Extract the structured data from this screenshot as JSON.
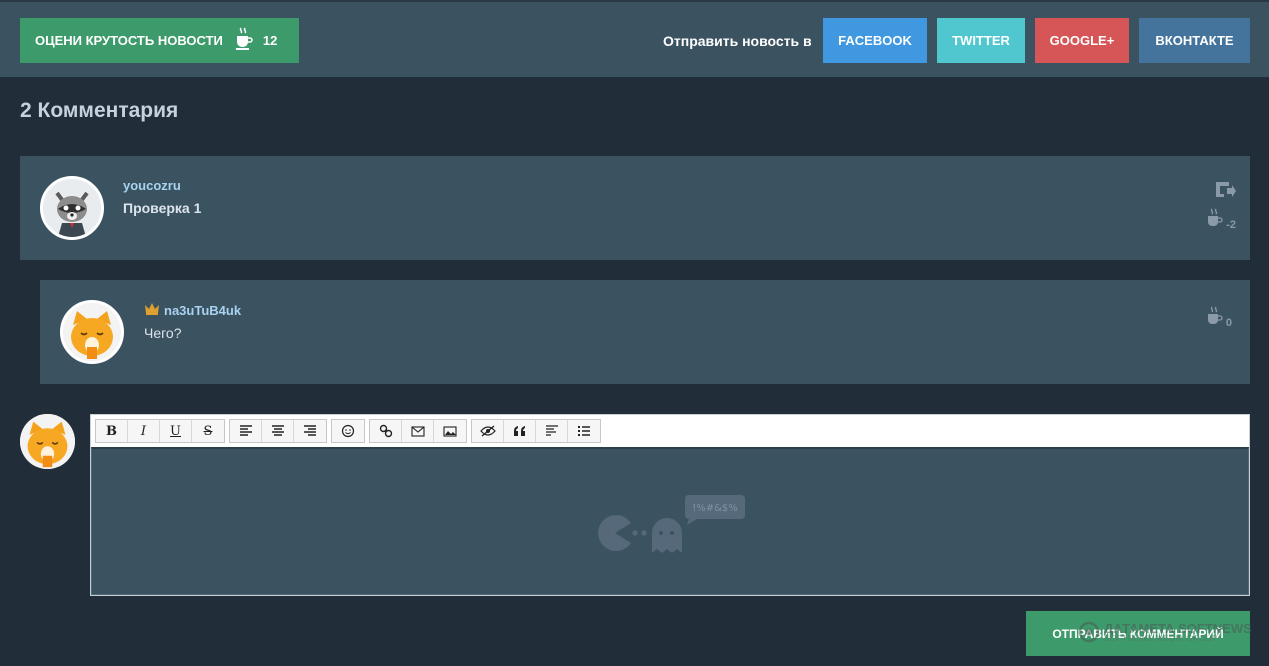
{
  "topbar": {
    "rate_label": "ОЦЕНИ КРУТОСТЬ НОВОСТИ",
    "rate_count": "12",
    "share_label": "Отправить новость в",
    "share_buttons": {
      "facebook": "FACEBOOK",
      "twitter": "TWITTER",
      "google": "GOOGLE+",
      "vk": "ВКОНТАКТЕ"
    }
  },
  "comments_title": "2 Комментария",
  "comments": [
    {
      "author": "youcozru",
      "text": "Проверка 1",
      "score": "-2"
    },
    {
      "author": "na3uTuB4uk",
      "text": "Чего?",
      "score": "0"
    }
  ],
  "editor": {
    "toolbar_icons": [
      "bold-icon",
      "italic-icon",
      "underline-icon",
      "strike-icon",
      "align-left-icon",
      "align-center-icon",
      "align-right-icon",
      "smile-icon",
      "link-icon",
      "email-icon",
      "image-icon",
      "hide-icon",
      "quote-icon",
      "code-icon",
      "list-icon"
    ],
    "toolbar_labels": {
      "bold": "B",
      "italic": "I",
      "underline": "U",
      "strike": "S"
    },
    "bubble_text": "!%#&$%"
  },
  "submit_label": "ОТПРАВИТЬ КОММЕНТАРИЙ",
  "watermark": {
    "main": "ДАТАМЕТА SOFTNEWS",
    "sub": "SOFTNEWS MEDIA GROUP"
  },
  "colors": {
    "accent_green": "#3d9a6a",
    "facebook": "#3f98e0",
    "twitter": "#50c7cf",
    "google": "#d65657",
    "vk": "#44739c",
    "panel": "#3b5261",
    "background": "#212d38"
  }
}
